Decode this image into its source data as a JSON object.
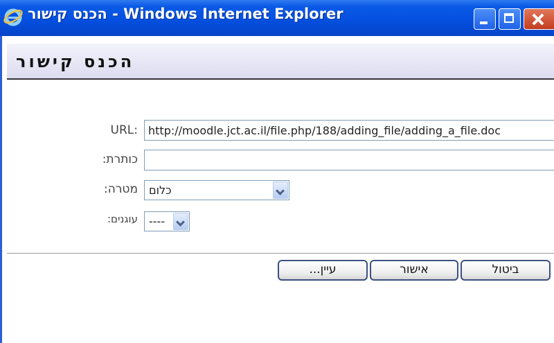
{
  "window": {
    "title_hebrew": "הכנס קישור",
    "title_suffix": " - Windows Internet Explorer"
  },
  "dialog": {
    "heading": "הכנס קישור"
  },
  "form": {
    "url_label": "URL:",
    "url_value": "http://moodle.jct.ac.il/file.php/188/adding_file/adding_a_file.doc",
    "title_label": "כותרת:",
    "title_value": "",
    "target_label": "מטרה:",
    "target_value": "כלום",
    "smilies_label": "עוגנים:",
    "smilies_value": "----"
  },
  "buttons": {
    "browse": "עיין...",
    "ok": "אישור",
    "cancel": "ביטול"
  },
  "icons": {
    "app": "internet-explorer-icon",
    "minimize": "minimize-icon",
    "maximize": "maximize-icon",
    "close": "close-icon",
    "dropdown": "chevron-down-icon"
  }
}
